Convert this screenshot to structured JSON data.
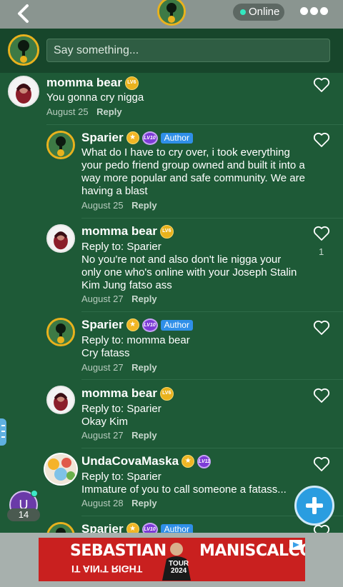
{
  "header": {
    "status_label": "Online",
    "icons": [
      "back-chevron-icon",
      "more-dots-icon"
    ]
  },
  "compose": {
    "placeholder": "Say something..."
  },
  "comments": [
    {
      "author": "momma bear",
      "level": "LV6",
      "text": "You gonna cry nigga",
      "date": "August 25",
      "reply_label": "Reply"
    },
    {
      "author": "Sparier",
      "level": "LV10",
      "author_tag": "Author",
      "text": "What do I have to cry over, i took everything your pedo friend group owned and built it into a way more popular and safe community. We are having a blast",
      "date": "August 25",
      "reply_label": "Reply"
    },
    {
      "author": "momma bear",
      "level": "LV6",
      "reply_to": "Reply to: Sparier",
      "text": "No you're not and also don't lie nigga your only one who's online with your Joseph Stalin Kim Jung fatso ass",
      "date": "August 27",
      "reply_label": "Reply",
      "likes": "1"
    },
    {
      "author": "Sparier",
      "level": "LV10",
      "author_tag": "Author",
      "reply_to": "Reply to: momma bear",
      "text": "Cry fatass",
      "date": "August 27",
      "reply_label": "Reply"
    },
    {
      "author": "momma bear",
      "level": "LV6",
      "reply_to": "Reply to: Sparier",
      "text": "Okay Kim",
      "date": "August 27",
      "reply_label": "Reply"
    },
    {
      "author": "UndaCovaMaska",
      "level": "LV11",
      "reply_to": "Reply to: Sparier",
      "text": "Immature of you to call someone a fatass...",
      "date": "August 28",
      "reply_label": "Reply"
    },
    {
      "author": "Sparier",
      "level": "LV10",
      "author_tag": "Author"
    }
  ],
  "online_users": {
    "initial": "U",
    "count": "14"
  },
  "ad": {
    "headline_left": "SEBASTIAN",
    "headline_right": "MANISCALCO",
    "subline": "IT AIN'T RIGHT",
    "tour": "TOUR",
    "year": "2024"
  },
  "colors": {
    "background": "#1e5a37",
    "accent_gold": "#e9b21d",
    "author_badge": "#2f8fe8",
    "fab": "#2a9de0"
  }
}
